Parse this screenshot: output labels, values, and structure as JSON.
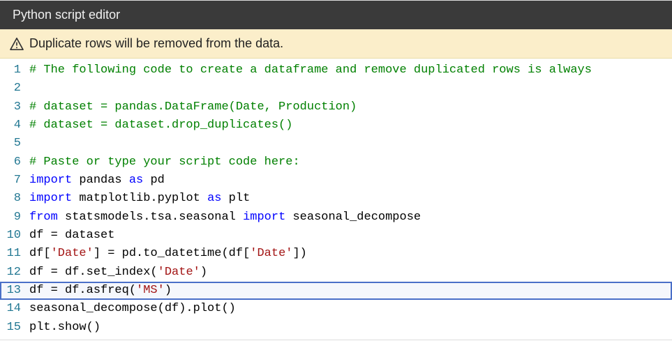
{
  "header": {
    "title": "Python script editor"
  },
  "warning": {
    "message": "Duplicate rows will be removed from the data."
  },
  "code": {
    "highlight": 13,
    "lines": [
      {
        "n": 1,
        "tokens": [
          {
            "t": "# The following code to create a dataframe and remove duplicated rows is always",
            "c": "tok-comment"
          }
        ]
      },
      {
        "n": 2,
        "tokens": [
          {
            "t": "",
            "c": ""
          }
        ]
      },
      {
        "n": 3,
        "tokens": [
          {
            "t": "# dataset = pandas.DataFrame(Date, Production)",
            "c": "tok-comment"
          }
        ]
      },
      {
        "n": 4,
        "tokens": [
          {
            "t": "# dataset = dataset.drop_duplicates()",
            "c": "tok-comment"
          }
        ]
      },
      {
        "n": 5,
        "tokens": [
          {
            "t": "",
            "c": ""
          }
        ]
      },
      {
        "n": 6,
        "tokens": [
          {
            "t": "# Paste or type your script code here:",
            "c": "tok-comment"
          }
        ]
      },
      {
        "n": 7,
        "tokens": [
          {
            "t": "import",
            "c": "tok-keyword"
          },
          {
            "t": " pandas ",
            "c": ""
          },
          {
            "t": "as",
            "c": "tok-keyword"
          },
          {
            "t": " pd",
            "c": ""
          }
        ]
      },
      {
        "n": 8,
        "tokens": [
          {
            "t": "import",
            "c": "tok-keyword"
          },
          {
            "t": " matplotlib.pyplot ",
            "c": ""
          },
          {
            "t": "as",
            "c": "tok-keyword"
          },
          {
            "t": " plt",
            "c": ""
          }
        ]
      },
      {
        "n": 9,
        "tokens": [
          {
            "t": "from",
            "c": "tok-keyword"
          },
          {
            "t": " statsmodels.tsa.seasonal ",
            "c": ""
          },
          {
            "t": "import",
            "c": "tok-keyword"
          },
          {
            "t": " seasonal_decompose",
            "c": ""
          }
        ]
      },
      {
        "n": 10,
        "tokens": [
          {
            "t": "df = dataset",
            "c": ""
          }
        ]
      },
      {
        "n": 11,
        "tokens": [
          {
            "t": "df[",
            "c": ""
          },
          {
            "t": "'Date'",
            "c": "tok-string"
          },
          {
            "t": "] = pd.to_datetime(df[",
            "c": ""
          },
          {
            "t": "'Date'",
            "c": "tok-string"
          },
          {
            "t": "])",
            "c": ""
          }
        ]
      },
      {
        "n": 12,
        "tokens": [
          {
            "t": "df = df.set_index(",
            "c": ""
          },
          {
            "t": "'Date'",
            "c": "tok-string"
          },
          {
            "t": ")",
            "c": ""
          }
        ]
      },
      {
        "n": 13,
        "tokens": [
          {
            "t": "df = df.asfreq(",
            "c": ""
          },
          {
            "t": "'MS'",
            "c": "tok-string"
          },
          {
            "t": ")",
            "c": ""
          }
        ]
      },
      {
        "n": 14,
        "tokens": [
          {
            "t": "seasonal_decompose(df).plot()",
            "c": ""
          }
        ]
      },
      {
        "n": 15,
        "tokens": [
          {
            "t": "plt.show()",
            "c": ""
          }
        ]
      }
    ]
  }
}
